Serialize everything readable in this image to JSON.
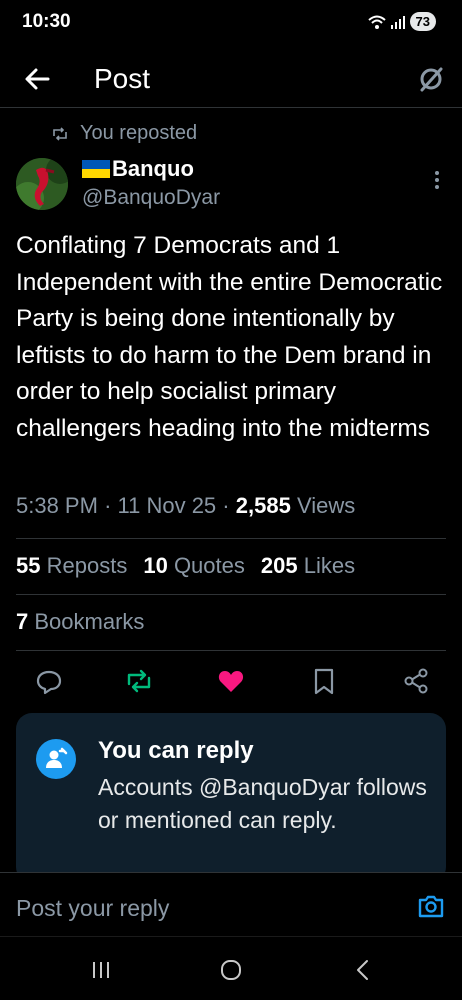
{
  "status_bar": {
    "time": "10:30",
    "battery": "73"
  },
  "header": {
    "title": "Post"
  },
  "reposted_label": "You reposted",
  "author": {
    "display_name": "Banquo",
    "handle": "@BanquoDyar"
  },
  "post": {
    "text": "Conflating 7 Democrats and 1 Independent with the entire Democratic Party is being done intentionally by leftists to do harm to the Dem brand in order to help socialist primary challengers heading into the midterms",
    "time": "5:38 PM",
    "separator": "·",
    "date": "11 Nov 25",
    "views_count": "2,585",
    "views_label": "Views"
  },
  "stats": {
    "reposts_count": "55",
    "reposts_label": "Reposts",
    "quotes_count": "10",
    "quotes_label": "Quotes",
    "likes_count": "205",
    "likes_label": "Likes",
    "bookmarks_count": "7",
    "bookmarks_label": "Bookmarks"
  },
  "colors": {
    "repost": "#00ba7c",
    "like": "#f91880",
    "accent": "#1d9bf0"
  },
  "reply_notice": {
    "title": "You can reply",
    "description": "Accounts @BanquoDyar follows or mentioned can reply."
  },
  "reply_bar": {
    "placeholder": "Post your reply"
  }
}
